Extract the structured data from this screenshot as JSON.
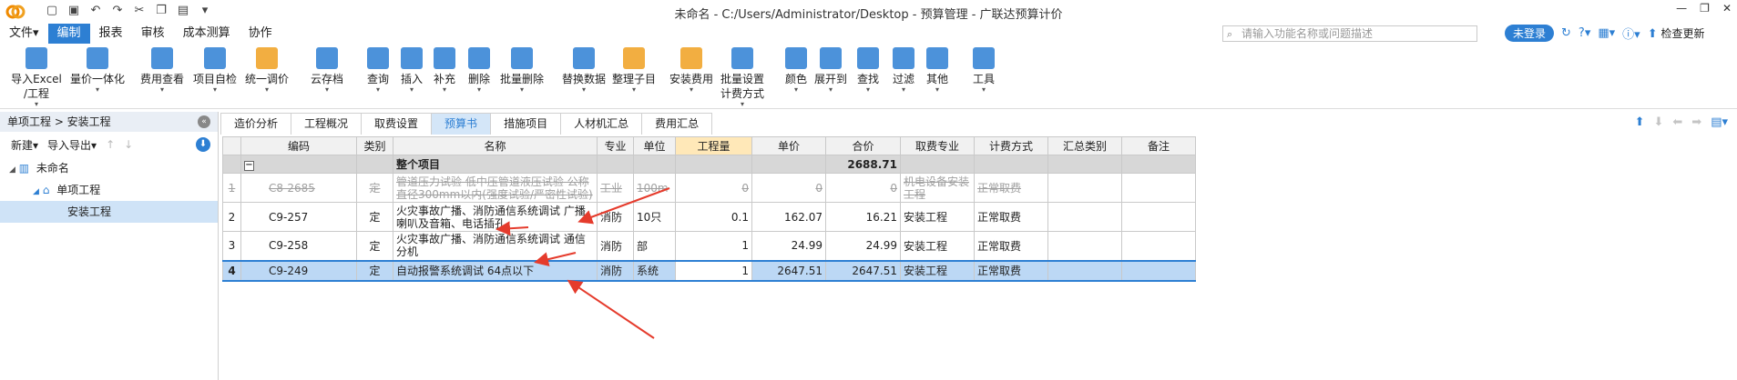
{
  "window": {
    "title": "未命名 - C:/Users/Administrator/Desktop - 预算管理 - 广联达预算计价"
  },
  "menu": {
    "items": [
      "文件▾",
      "编制",
      "报表",
      "审核",
      "成本测算",
      "协作"
    ],
    "active_index": 1
  },
  "search": {
    "placeholder": "请输入功能名称或问题描述"
  },
  "topright": {
    "login_label": "未登录",
    "update_label": "检查更新"
  },
  "ribbon": {
    "buttons": [
      {
        "label": "导入Excel\n/工程",
        "icon": "import-excel-icon",
        "color": "#2d7fd3"
      },
      {
        "label": "量价一体化",
        "icon": "quantity-price-icon",
        "color": "#2d7fd3"
      },
      {
        "label": "费用查看",
        "icon": "fee-view-icon",
        "color": "#2d7fd3"
      },
      {
        "label": "项目自检",
        "icon": "self-check-icon",
        "color": "#2d7fd3"
      },
      {
        "label": "统一调价",
        "icon": "price-adjust-icon",
        "color": "#f0a020"
      },
      {
        "label": "云存档",
        "icon": "cloud-archive-icon",
        "color": "#2d7fd3"
      },
      {
        "label": "查询",
        "icon": "query-icon",
        "color": "#2d7fd3"
      },
      {
        "label": "插入",
        "icon": "insert-icon",
        "color": "#2d7fd3"
      },
      {
        "label": "补充",
        "icon": "supplement-icon",
        "color": "#2d7fd3"
      },
      {
        "label": "删除",
        "icon": "delete-icon",
        "color": "#2d7fd3"
      },
      {
        "label": "批量删除",
        "icon": "batch-delete-icon",
        "color": "#2d7fd3"
      },
      {
        "label": "替换数据",
        "icon": "replace-data-icon",
        "color": "#2d7fd3"
      },
      {
        "label": "整理子目",
        "icon": "organize-items-icon",
        "color": "#f0a020"
      },
      {
        "label": "安装费用",
        "icon": "install-fee-icon",
        "color": "#f0a020"
      },
      {
        "label": "批量设置\n计费方式",
        "icon": "batch-fee-mode-icon",
        "color": "#2d7fd3"
      },
      {
        "label": "颜色",
        "icon": "color-icon",
        "color": "#2d7fd3"
      },
      {
        "label": "展开到",
        "icon": "expand-to-icon",
        "color": "#2d7fd3"
      },
      {
        "label": "查找",
        "icon": "find-icon",
        "color": "#2d7fd3"
      },
      {
        "label": "过滤",
        "icon": "filter-icon",
        "color": "#2d7fd3"
      },
      {
        "label": "其他",
        "icon": "other-icon",
        "color": "#2d7fd3"
      },
      {
        "label": "工具",
        "icon": "tools-icon",
        "color": "#2d7fd3"
      }
    ]
  },
  "leftpane": {
    "breadcrumb": "单项工程 > 安装工程",
    "new_label": "新建▾",
    "import_export_label": "导入导出▾",
    "tree": [
      {
        "label": "未命名",
        "level": 0
      },
      {
        "label": "单项工程",
        "level": 1
      },
      {
        "label": "安装工程",
        "level": 2
      }
    ]
  },
  "tabs": [
    "造价分析",
    "工程概况",
    "取费设置",
    "预算书",
    "措施项目",
    "人材机汇总",
    "费用汇总"
  ],
  "active_tab": 3,
  "table": {
    "columns": [
      "编码",
      "类别",
      "名称",
      "专业",
      "单位",
      "工程量",
      "单价",
      "合价",
      "取费专业",
      "计费方式",
      "汇总类别",
      "备注"
    ],
    "total_row": {
      "expand": "−",
      "name": "整个项目",
      "total": "2688.71"
    },
    "rows": [
      {
        "idx": "1",
        "code": "C8-2685",
        "type": "定",
        "name": "管道压力试验 低中压管道液压试验 公称直径300mm以内(强度试验/严密性试验)",
        "spec": "工业",
        "unit": "100m",
        "qty": "0",
        "price": "0",
        "total": "0",
        "fee_spec": "机电设备安装工程",
        "fee_mode": "正常取费",
        "sum_type": "",
        "note": ""
      },
      {
        "idx": "2",
        "code": "C9-257",
        "type": "定",
        "name": "火灾事故广播、消防通信系统调试 广播喇叭及音箱、电话插孔",
        "spec": "消防",
        "unit": "10只",
        "qty": "0.1",
        "price": "162.07",
        "total": "16.21",
        "fee_spec": "安装工程",
        "fee_mode": "正常取费",
        "sum_type": "",
        "note": ""
      },
      {
        "idx": "3",
        "code": "C9-258",
        "type": "定",
        "name": "火灾事故广播、消防通信系统调试 通信分机",
        "spec": "消防",
        "unit": "部",
        "qty": "1",
        "price": "24.99",
        "total": "24.99",
        "fee_spec": "安装工程",
        "fee_mode": "正常取费",
        "sum_type": "",
        "note": ""
      },
      {
        "idx": "4",
        "code": "C9-249",
        "type": "定",
        "name": "自动报警系统调试 64点以下",
        "spec": "消防",
        "unit": "系统",
        "qty": "1",
        "price": "2647.51",
        "total": "2647.51",
        "fee_spec": "安装工程",
        "fee_mode": "正常取费",
        "sum_type": "",
        "note": ""
      }
    ]
  },
  "colors": {
    "accent": "#2d7fd3",
    "annotation": "#e53b2c"
  }
}
